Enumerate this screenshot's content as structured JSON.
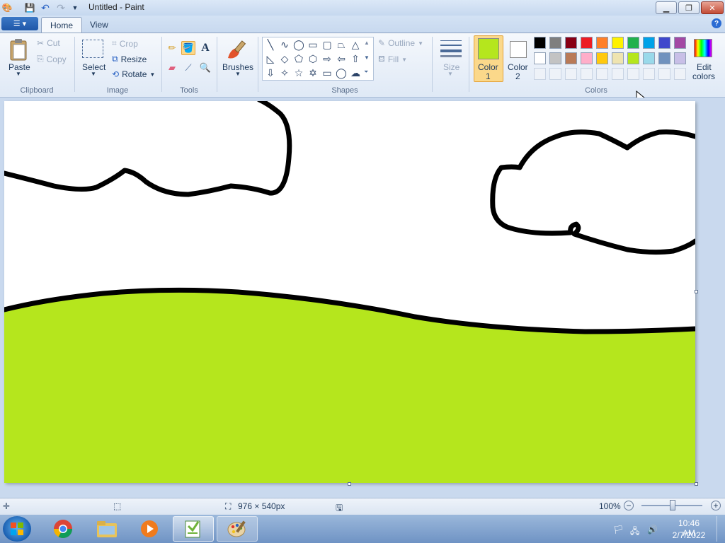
{
  "window": {
    "title": "Untitled - Paint"
  },
  "tabs": {
    "home": "Home",
    "view": "View"
  },
  "clipboard": {
    "label": "Clipboard",
    "paste": "Paste",
    "cut": "Cut",
    "copy": "Copy"
  },
  "image": {
    "label": "Image",
    "select": "Select",
    "crop": "Crop",
    "resize": "Resize",
    "rotate": "Rotate"
  },
  "tools": {
    "label": "Tools"
  },
  "brushes": {
    "label": "Brushes"
  },
  "shapes": {
    "label": "Shapes",
    "outline": "Outline",
    "fill": "Fill"
  },
  "size": {
    "label": "Size"
  },
  "colors": {
    "label": "Colors",
    "color1": "Color",
    "color1_num": "1",
    "color2": "Color",
    "color2_num": "2",
    "edit1": "Edit",
    "edit2": "colors",
    "color1_value": "#b5e61d",
    "color2_value": "#ffffff",
    "palette_row1": [
      "#000000",
      "#7f7f7f",
      "#880015",
      "#ed1c24",
      "#ff7f27",
      "#fff200",
      "#22b14c",
      "#00a2e8",
      "#3f48cc",
      "#a349a4"
    ],
    "palette_row2": [
      "#ffffff",
      "#c3c3c3",
      "#b97a57",
      "#ffaec9",
      "#ffc90e",
      "#efe4b0",
      "#b5e61d",
      "#99d9ea",
      "#7092be",
      "#c8bfe7"
    ]
  },
  "canvas": {
    "fill_color": "#b5e61d",
    "stroke_color": "#000000"
  },
  "status": {
    "dimensions": "976 × 540px",
    "zoom": "100%"
  },
  "taskbar": {
    "time": "10:46 AM",
    "date": "2/7/2022"
  }
}
